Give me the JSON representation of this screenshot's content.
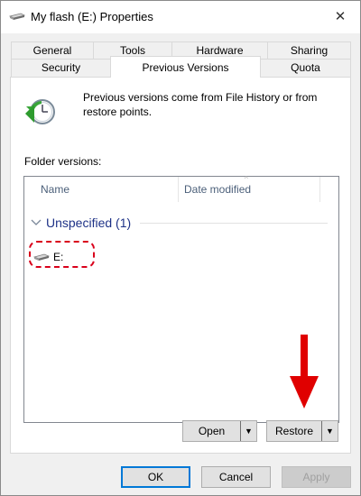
{
  "window": {
    "title": "My flash (E:) Properties",
    "close_glyph": "✕"
  },
  "tabs": {
    "row1": [
      "General",
      "Tools",
      "Hardware",
      "Sharing"
    ],
    "row2": [
      "Security",
      "Previous Versions",
      "Quota"
    ],
    "active": "Previous Versions"
  },
  "panel": {
    "info_text": "Previous versions come from File History or from restore points.",
    "folder_label": "Folder versions:",
    "columns": [
      "Name",
      "Date modified"
    ],
    "group": {
      "title": "Unspecified (1)"
    },
    "items": [
      {
        "label": "E:"
      }
    ]
  },
  "buttons": {
    "open": "Open",
    "restore": "Restore",
    "ok": "OK",
    "cancel": "Cancel",
    "apply": "Apply",
    "apply_enabled": false
  },
  "icons": {
    "title": "usb-drive-icon",
    "info": "restore-clock-icon",
    "item": "usb-drive-icon",
    "annotation": "red-arrow-icon"
  },
  "colors": {
    "group_title": "#1e3287",
    "annotation": "#d9001b",
    "default_button_border": "#0078d7"
  }
}
